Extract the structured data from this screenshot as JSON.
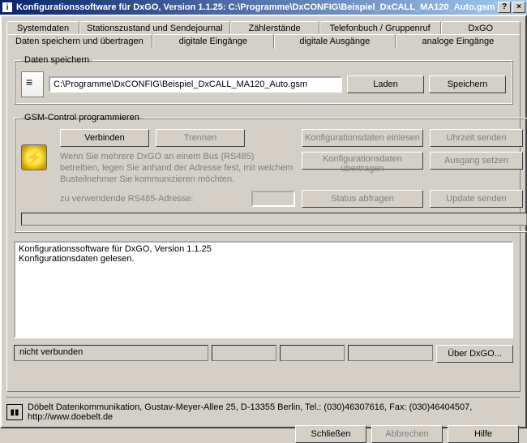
{
  "window": {
    "title": "Konfigurationssoftware für DxGO, Version 1.1.25:     C:\\Programme\\DxCONFIG\\Beispiel_DxCALL_MA120_Auto.gsm",
    "help_icon": "?",
    "close_icon": "×"
  },
  "tabs_back": [
    "Systemdaten",
    "Stationszustand und Sendejournal",
    "Zählerstände",
    "Telefonbuch / Gruppenruf",
    "DxGO"
  ],
  "tabs_front": [
    "Daten speichern und übertragen",
    "digitale Eingänge",
    "digitale Ausgänge",
    "analoge Eingänge"
  ],
  "active_tab": "Daten speichern und übertragen",
  "save_group": {
    "legend": "Daten speichern",
    "path": "C:\\Programme\\DxCONFIG\\Beispiel_DxCALL_MA120_Auto.gsm",
    "load": "Laden",
    "save": "Speichern"
  },
  "gsm_group": {
    "legend": "GSM-Control programmieren",
    "connect": "Verbinden",
    "disconnect": "Trennen",
    "read_config": "Konfigurationsdaten einlesen",
    "send_time": "Uhrzeit senden",
    "instructions": "Wenn Sie mehrere DxGO an einem Bus (RS485) betreiben, legen Sie anhand der Adresse fest, mit welchem Busteilnehmer Sie kommunizieren möchten.",
    "write_config": "Konfigurationsdaten übertragen",
    "set_output": "Ausgang setzen",
    "addr_label": "zu verwendende RS485-Adresse:",
    "addr_value": "",
    "query_status": "Status abfragen",
    "send_update": "Update senden"
  },
  "log": "Konfigurationssoftware für DxGO, Version 1.1.25\nKonfigurationsdaten gelesen.",
  "status": {
    "connection": "nicht verbunden",
    "about": "Über DxGO..."
  },
  "footer": {
    "text": "Döbelt Datenkommunikation, Gustav-Meyer-Allee 25, D-13355 Berlin, Tel.: (030)46307616, Fax: (030)46404507, http://www.doebelt.de"
  },
  "buttons": {
    "close": "Schließen",
    "cancel": "Abbrechen",
    "help": "Hilfe"
  }
}
